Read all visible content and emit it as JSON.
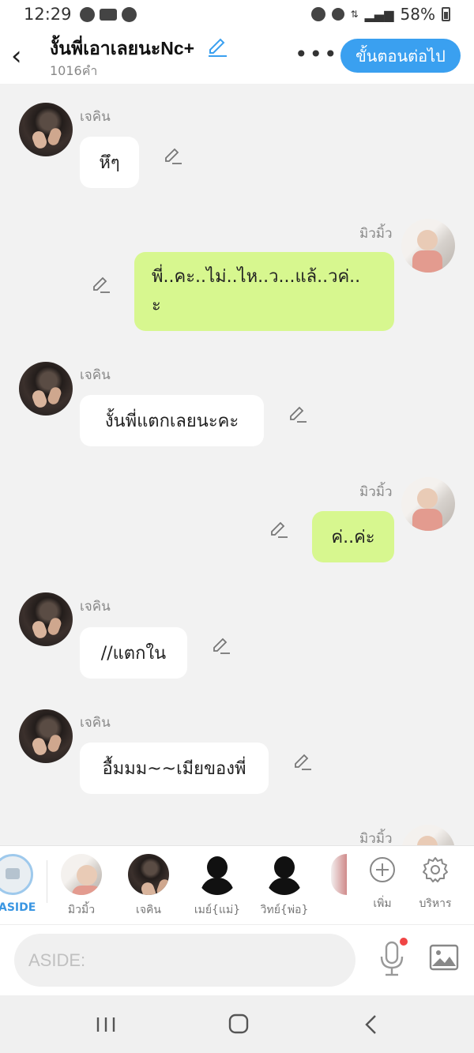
{
  "status_bar": {
    "time": "12:29",
    "battery": "58%"
  },
  "header": {
    "title": "งั้นพี่เอาเลยนะNc+",
    "word_count": "1016คำ",
    "next_button": "ขั้นตอนต่อไป"
  },
  "messages": [
    {
      "side": "left",
      "sender": "เจคิน",
      "lines": [
        "หึๆ"
      ]
    },
    {
      "side": "right",
      "sender": "มิวมิ้ว",
      "lines": [
        "พี่..คะ..ไม่..ไห..ว...แล้..วค่..",
        "ะ"
      ]
    },
    {
      "side": "left",
      "sender": "เจคิน",
      "lines": [
        "งั้นพี่แตกเลยนะคะ"
      ]
    },
    {
      "side": "right",
      "sender": "มิวมิ้ว",
      "lines": [
        "ค่..ค่ะ"
      ]
    },
    {
      "side": "left",
      "sender": "เจคิน",
      "lines": [
        "//แตกใน"
      ]
    },
    {
      "side": "left",
      "sender": "เจคิน",
      "lines": [
        "อื้มมม~~เมียของพี่"
      ]
    },
    {
      "side": "right",
      "sender": "มิวมิ้ว",
      "lines": []
    }
  ],
  "character_bar": {
    "aside_label": "ASIDE",
    "characters": [
      "มิวมิ้ว",
      "เจคิน",
      "เมย์{แม่}",
      "วิทย์{พ่อ}"
    ],
    "add_label": "เพิ่ม",
    "manage_label": "บริหาร"
  },
  "input": {
    "placeholder": "ASIDE:"
  },
  "icons": {
    "back": "chevron-left-icon",
    "edit": "pencil-icon",
    "more": "more-dots-icon",
    "mic": "microphone-icon",
    "image": "image-icon",
    "add": "plus-circle-icon",
    "settings": "gear-icon"
  },
  "colors": {
    "accent": "#3aa0f0",
    "right_bubble": "#d7f78f",
    "left_bubble": "#ffffff",
    "background": "#f2f2f2"
  }
}
